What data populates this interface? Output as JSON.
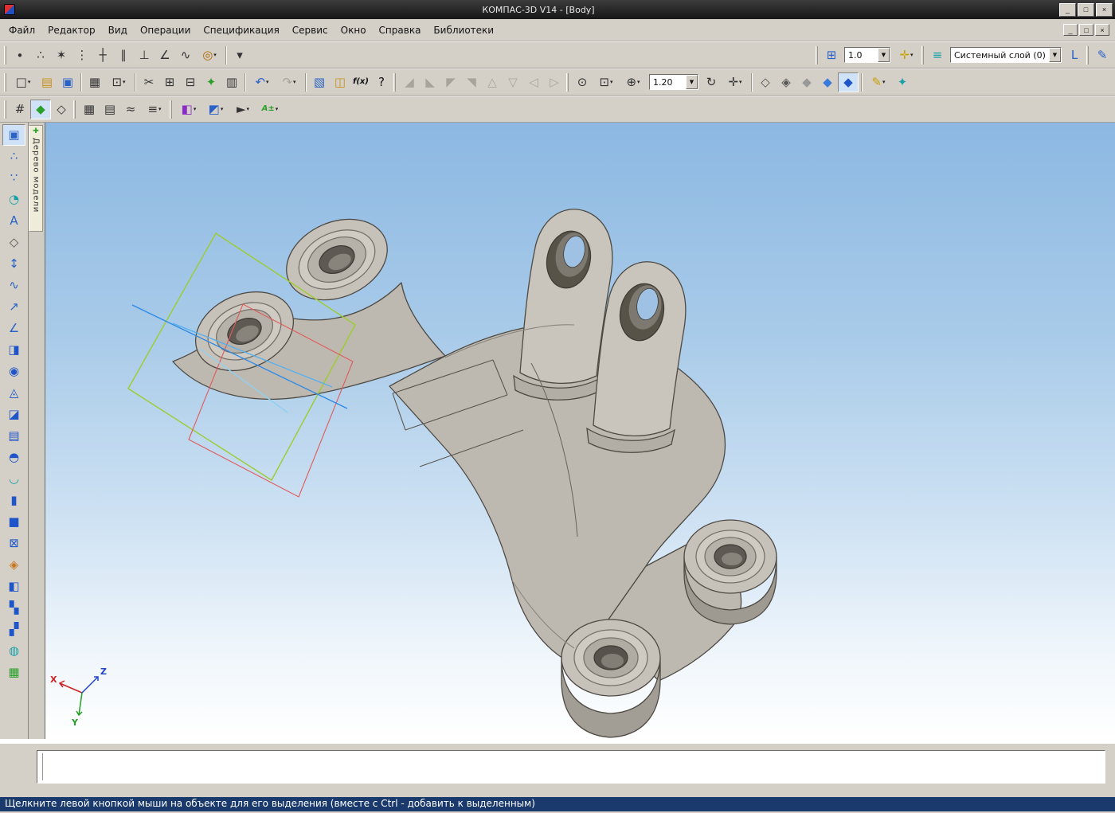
{
  "window": {
    "title": "КОМПАС-3D V14 - [Body]",
    "buttons": {
      "minimize": "_",
      "restore": "□",
      "close": "×"
    }
  },
  "menu": {
    "items": [
      "Файл",
      "Редактор",
      "Вид",
      "Операции",
      "Спецификация",
      "Сервис",
      "Окно",
      "Справка",
      "Библиотеки"
    ]
  },
  "toolbars": {
    "grid_step": "1.0",
    "layer": "Системный слой (0)",
    "zoom": "1.20",
    "row1_a": [
      {
        "grip": true
      },
      {
        "n": "point-input",
        "g": "∙",
        "c": "#333"
      },
      {
        "n": "points-on-curve",
        "g": "∴",
        "c": "#333"
      },
      {
        "n": "intersection-point",
        "g": "✶",
        "c": "#333"
      },
      {
        "n": "grid-points",
        "g": "⋮",
        "c": "#333"
      },
      {
        "n": "construction-axis",
        "g": "┼",
        "c": "#333"
      },
      {
        "n": "parallel-axis",
        "g": "∥",
        "c": "#333"
      },
      {
        "n": "perpendicular-axis",
        "g": "⊥",
        "c": "#333"
      },
      {
        "n": "angle-axis",
        "g": "∠",
        "c": "#333"
      },
      {
        "n": "wave-curve",
        "g": "∿",
        "c": "#333"
      },
      {
        "n": "spiral-tool",
        "g": "◎",
        "c": "#b06a00",
        "dd": true
      },
      {
        "sep": true
      },
      {
        "n": "toolbar-more",
        "g": "▾",
        "c": "#333"
      }
    ],
    "row1_b": [
      {
        "grip": true
      },
      {
        "n": "move-grid",
        "g": "⊞",
        "c": "#2a62c8"
      }
    ],
    "row1_c": [
      {
        "n": "global-snaps",
        "g": "✛",
        "c": "#c8a000",
        "dd": true
      }
    ],
    "row1_d": [
      {
        "grip": true
      },
      {
        "n": "layers",
        "g": "≡",
        "c": "#18a0a8"
      }
    ],
    "row1_e": [
      {
        "n": "local-coordinate-systems",
        "g": "L",
        "c": "#2a62c8"
      },
      {
        "grip": true
      },
      {
        "n": "measure-pencil",
        "g": "✎",
        "c": "#2a62c8"
      }
    ],
    "row2_a": [
      {
        "grip": true
      },
      {
        "n": "new-document",
        "g": "□",
        "c": "#333",
        "dd": true
      },
      {
        "n": "open-document",
        "g": "▤",
        "c": "#c89018"
      },
      {
        "n": "save-document",
        "g": "▣",
        "c": "#2a62c8"
      },
      {
        "sep": true
      },
      {
        "n": "print",
        "g": "▦",
        "c": "#333"
      },
      {
        "n": "print-preview",
        "g": "⊡",
        "c": "#333",
        "dd": true
      },
      {
        "sep": true
      },
      {
        "n": "cut",
        "g": "✂",
        "c": "#333"
      },
      {
        "n": "copy",
        "g": "⊞",
        "c": "#333"
      },
      {
        "n": "paste",
        "g": "⊟",
        "c": "#333"
      },
      {
        "n": "copy-properties",
        "g": "✦",
        "c": "#2aa02a"
      },
      {
        "n": "insert-object",
        "g": "▥",
        "c": "#333"
      },
      {
        "sep": true
      },
      {
        "n": "undo",
        "g": "↶",
        "c": "#2a62c8",
        "dd": true
      },
      {
        "n": "redo",
        "g": "↷",
        "c": "#2a62c8",
        "dd": true,
        "d": true
      },
      {
        "sep": true
      },
      {
        "n": "variables-panel",
        "g": "▧",
        "c": "#2a62c8"
      },
      {
        "n": "library-catalog",
        "g": "◫",
        "c": "#c89018"
      },
      {
        "n": "fx-variables",
        "g": "f(x)",
        "c": "#111"
      },
      {
        "n": "what-is-this-help",
        "g": "?",
        "c": "#111"
      }
    ],
    "row2_b": [
      {
        "grip": true
      },
      {
        "n": "sketch-on-plane",
        "g": "◢",
        "d": true
      },
      {
        "n": "sketch-edit",
        "g": "◣",
        "d": true
      },
      {
        "n": "project-geometry",
        "g": "◤",
        "d": true
      },
      {
        "n": "align-plane",
        "g": "◥",
        "d": true
      },
      {
        "n": "normal-to",
        "g": "△",
        "d": true
      },
      {
        "n": "placement",
        "g": "▽",
        "d": true
      },
      {
        "n": "constraint-tool",
        "g": "◁",
        "d": true
      },
      {
        "n": "dof-indicator",
        "g": "▷",
        "d": true
      },
      {
        "grip": true
      },
      {
        "n": "zoom-all",
        "g": "⊙",
        "c": "#333"
      },
      {
        "n": "zoom-window",
        "g": "⊡",
        "c": "#333",
        "dd": true
      },
      {
        "n": "zoom-scale",
        "g": "⊕",
        "c": "#333",
        "dd": true
      }
    ],
    "row2_c": [
      {
        "n": "rotate-view",
        "g": "↻",
        "c": "#333"
      },
      {
        "n": "view-orientation",
        "g": "✛",
        "c": "#333",
        "dd": true
      },
      {
        "sep": true
      },
      {
        "n": "wireframe-display",
        "g": "◇",
        "c": "#555"
      },
      {
        "n": "hidden-lines-display",
        "g": "◈",
        "c": "#555"
      },
      {
        "n": "hidden-thin-display",
        "g": "◆",
        "c": "#999"
      },
      {
        "n": "shaded-display",
        "g": "◆",
        "c": "#3a7ad8"
      },
      {
        "n": "shaded-edges-display",
        "g": "◆",
        "c": "#1f55c8",
        "p": true
      },
      {
        "sep": true
      },
      {
        "n": "perspective-display",
        "g": "✎",
        "c": "#c8a000",
        "dd": true
      },
      {
        "n": "refresh-view",
        "g": "✦",
        "c": "#18a0a8"
      }
    ],
    "row3_a": [
      {
        "grip": true
      },
      {
        "n": "cursor-snap-grid",
        "g": "#",
        "c": "#333"
      },
      {
        "n": "model-3d-view",
        "g": "◆",
        "c": "#2aa02a",
        "p": true
      },
      {
        "n": "assembly-view",
        "g": "◇",
        "c": "#333"
      },
      {
        "grip": true
      },
      {
        "n": "calculator",
        "g": "▦",
        "c": "#333"
      },
      {
        "n": "spreadsheet",
        "g": "▤",
        "c": "#333"
      },
      {
        "n": "mesh-density",
        "g": "≈",
        "c": "#333"
      },
      {
        "n": "structure-tree",
        "g": "≡",
        "c": "#333",
        "dd": true
      },
      {
        "grip": true
      },
      {
        "n": "section-zones",
        "g": "◧",
        "c": "#8a2ac8",
        "dd": true
      },
      {
        "n": "quick-planes",
        "g": "◩",
        "c": "#2a62c8",
        "dd": true
      },
      {
        "n": "direction-indicator",
        "g": "►",
        "c": "#333",
        "dd": true
      },
      {
        "n": "auto-dimension",
        "g": "A±",
        "c": "#2aa02a",
        "dd": true
      }
    ]
  },
  "sidebar": {
    "icons": [
      {
        "n": "model-edit-mode",
        "g": "▣",
        "c": "#2a62c8",
        "p": true
      },
      {
        "n": "points-3d",
        "g": "∴",
        "c": "#2a62c8"
      },
      {
        "n": "points-array",
        "g": "∵",
        "c": "#2a62c8"
      },
      {
        "n": "spiral-3d",
        "g": "◔",
        "c": "#18a0a8"
      },
      {
        "n": "text-label",
        "g": "A",
        "c": "#2a62c8"
      },
      {
        "n": "plane-tool",
        "g": "◇",
        "c": "#555"
      },
      {
        "n": "local-cs",
        "g": "↕",
        "c": "#2a62c8"
      },
      {
        "n": "spline-3d",
        "g": "∿",
        "c": "#2a62c8"
      },
      {
        "n": "trajectory-curve",
        "g": "↗",
        "c": "#2a62c8"
      },
      {
        "n": "conic-section",
        "g": "∠",
        "c": "#2a62c8"
      },
      {
        "n": "extrude-operation",
        "g": "◨",
        "c": "#1f55c8"
      },
      {
        "n": "revolve-operation",
        "g": "◉",
        "c": "#1f55c8"
      },
      {
        "n": "loft-operation",
        "g": "◬",
        "c": "#1f55c8"
      },
      {
        "n": "sweep-operation",
        "g": "◪",
        "c": "#1f55c8"
      },
      {
        "n": "sheet-operation",
        "g": "▤",
        "c": "#1f55c8"
      },
      {
        "n": "dome-operation",
        "g": "◓",
        "c": "#1f55c8"
      },
      {
        "n": "shell-operation",
        "g": "◡",
        "c": "#18a0a8"
      },
      {
        "n": "cylinder-feature",
        "g": "▮",
        "c": "#1f55c8"
      },
      {
        "n": "box-feature",
        "g": "■",
        "c": "#1f55c8"
      },
      {
        "n": "boolean-operation",
        "g": "⊠",
        "c": "#1f55c8"
      },
      {
        "n": "gear-feature",
        "g": "◈",
        "c": "#c87820"
      },
      {
        "n": "face-edit",
        "g": "◧",
        "c": "#1f55c8"
      },
      {
        "n": "stairs-feature",
        "g": "▚",
        "c": "#1f55c8"
      },
      {
        "n": "pattern-array",
        "g": "▞",
        "c": "#1f55c8"
      },
      {
        "n": "check-collisions",
        "g": "◍",
        "c": "#18a0a8"
      },
      {
        "n": "mesh-grid",
        "g": "▦",
        "c": "#2aa02a"
      }
    ]
  },
  "model_tree": {
    "tab_label": "Дерево модели",
    "tab_icon": "✚"
  },
  "viewport": {
    "axes": {
      "x": "X",
      "y": "Y",
      "z": "Z"
    }
  },
  "status": {
    "text": "Щелкните левой кнопкой мыши на объекте для его выделения (вместе с Ctrl - добавить к выделенным)"
  }
}
